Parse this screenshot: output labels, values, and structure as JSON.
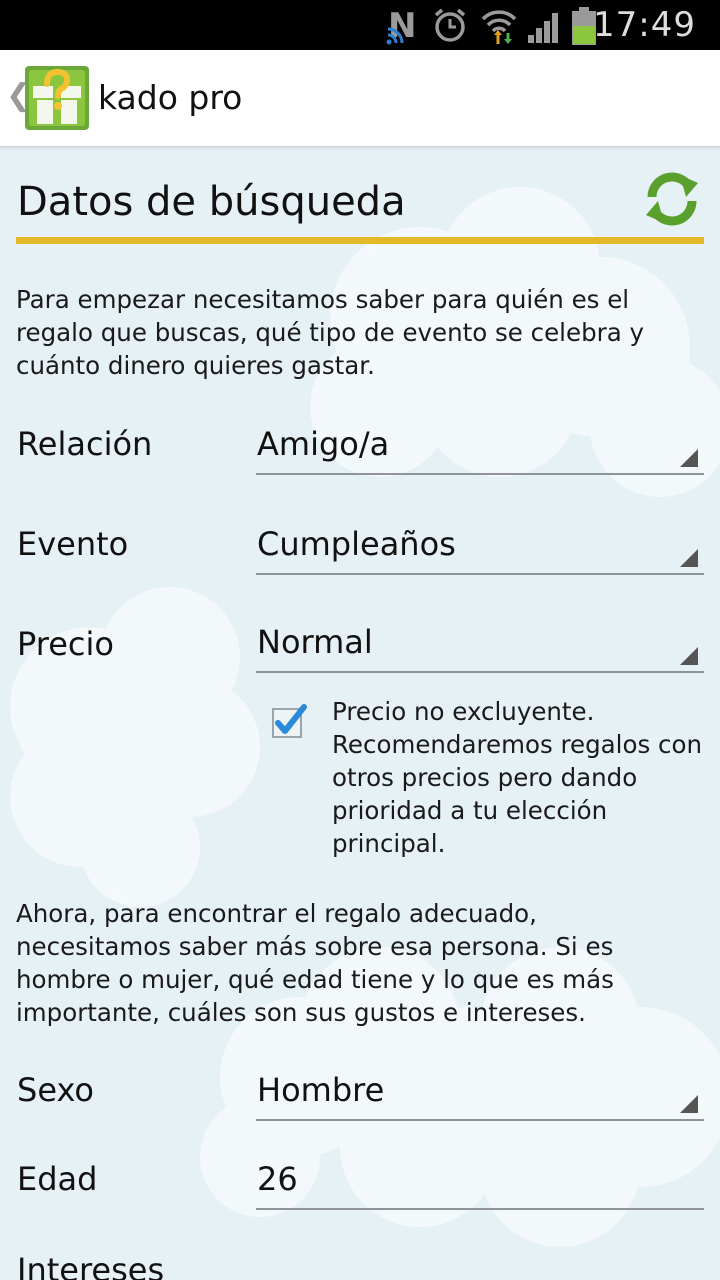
{
  "status_bar": {
    "time": "17:49",
    "icons": [
      "n-notification-icon",
      "alarm-clock-icon",
      "wifi-icon",
      "signal-icon",
      "battery-icon"
    ],
    "battery_color": "#8cc63f"
  },
  "action_bar": {
    "title": "kado pro",
    "logo": "gift-question-logo",
    "back_icon": "chevron-left-icon"
  },
  "form": {
    "section_title": "Datos de búsqueda",
    "accent_color": "#e3b929",
    "refresh_icon": "refresh-icon",
    "intro": "Para empezar necesitamos saber para quién es el regalo que buscas, qué tipo de evento se celebra y cuánto dinero quieres gastar.",
    "relacion": {
      "label": "Relación",
      "value": "Amigo/a"
    },
    "evento": {
      "label": "Evento",
      "value": "Cumpleaños"
    },
    "precio": {
      "label": "Precio",
      "value": "Normal"
    },
    "precio_checkbox": {
      "checked": true,
      "text": "Precio no excluyente. Recomendaremos regalos con otros precios pero dando prioridad a tu elección principal."
    },
    "intro2": "Ahora, para encontrar el regalo adecuado, necesitamos saber más sobre esa persona. Si es hombre o mujer, qué edad tiene y lo que es más importante, cuáles son sus gustos e intereses.",
    "sexo": {
      "label": "Sexo",
      "value": "Hombre"
    },
    "edad": {
      "label": "Edad",
      "value": "26"
    },
    "intereses": {
      "label": "Intereses"
    }
  }
}
